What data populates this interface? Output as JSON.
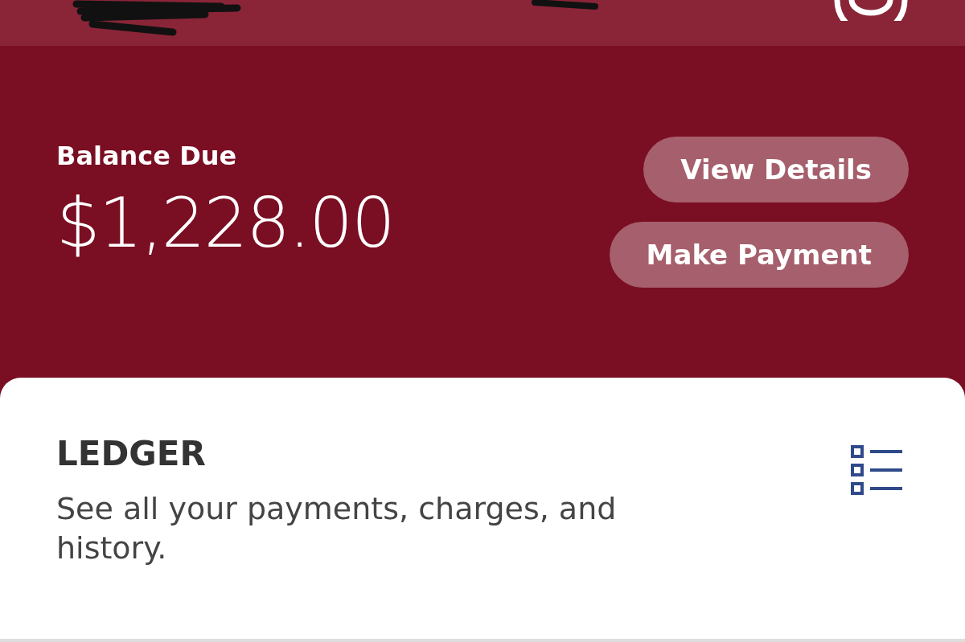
{
  "balance": {
    "label": "Balance Due",
    "amount": "$1,228.00"
  },
  "actions": [
    "View Details",
    "Make Payment"
  ],
  "ledger": {
    "title": "LEDGER",
    "description": "See all your payments, charges, and history."
  }
}
